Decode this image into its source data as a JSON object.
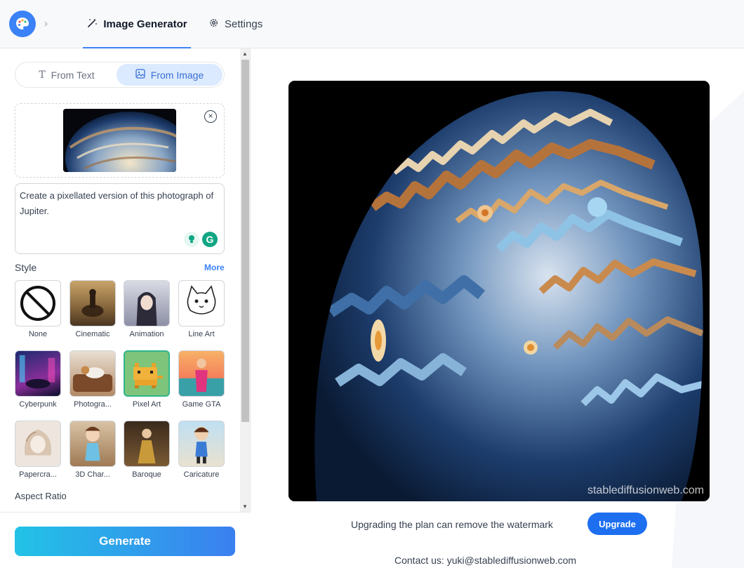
{
  "nav": {
    "tabs": [
      {
        "label": "Image Generator",
        "icon": "magic-wand-icon",
        "active": true
      },
      {
        "label": "Settings",
        "icon": "gear-icon",
        "active": false
      }
    ]
  },
  "mode": {
    "options": [
      {
        "label": "From Text",
        "icon": "text-icon",
        "active": false
      },
      {
        "label": "From Image",
        "icon": "image-icon",
        "active": true
      }
    ]
  },
  "prompt": {
    "value": "Create a pixellated version of this photograph of Jupiter."
  },
  "style": {
    "label": "Style",
    "more": "More",
    "selected": "Pixel Art",
    "items": [
      {
        "name": "None"
      },
      {
        "name": "Cinematic"
      },
      {
        "name": "Animation"
      },
      {
        "name": "Line Art"
      },
      {
        "name": "Cyberpunk"
      },
      {
        "name": "Photogra..."
      },
      {
        "name": "Pixel Art"
      },
      {
        "name": "Game GTA"
      },
      {
        "name": "Papercra..."
      },
      {
        "name": "3D Char..."
      },
      {
        "name": "Baroque"
      },
      {
        "name": "Caricature"
      }
    ]
  },
  "aspect": {
    "label": "Aspect Ratio"
  },
  "generate": {
    "label": "Generate"
  },
  "result": {
    "watermark": "stablediffusionweb.com",
    "notice": "Upgrading the plan can remove the watermark",
    "upgrade_label": "Upgrade",
    "contact": "Contact us: yuki@stablediffusionweb.com"
  },
  "colors": {
    "accent": "#3b82f6",
    "selected_border": "#2fb58b",
    "upgrade": "#1d6ff0"
  }
}
